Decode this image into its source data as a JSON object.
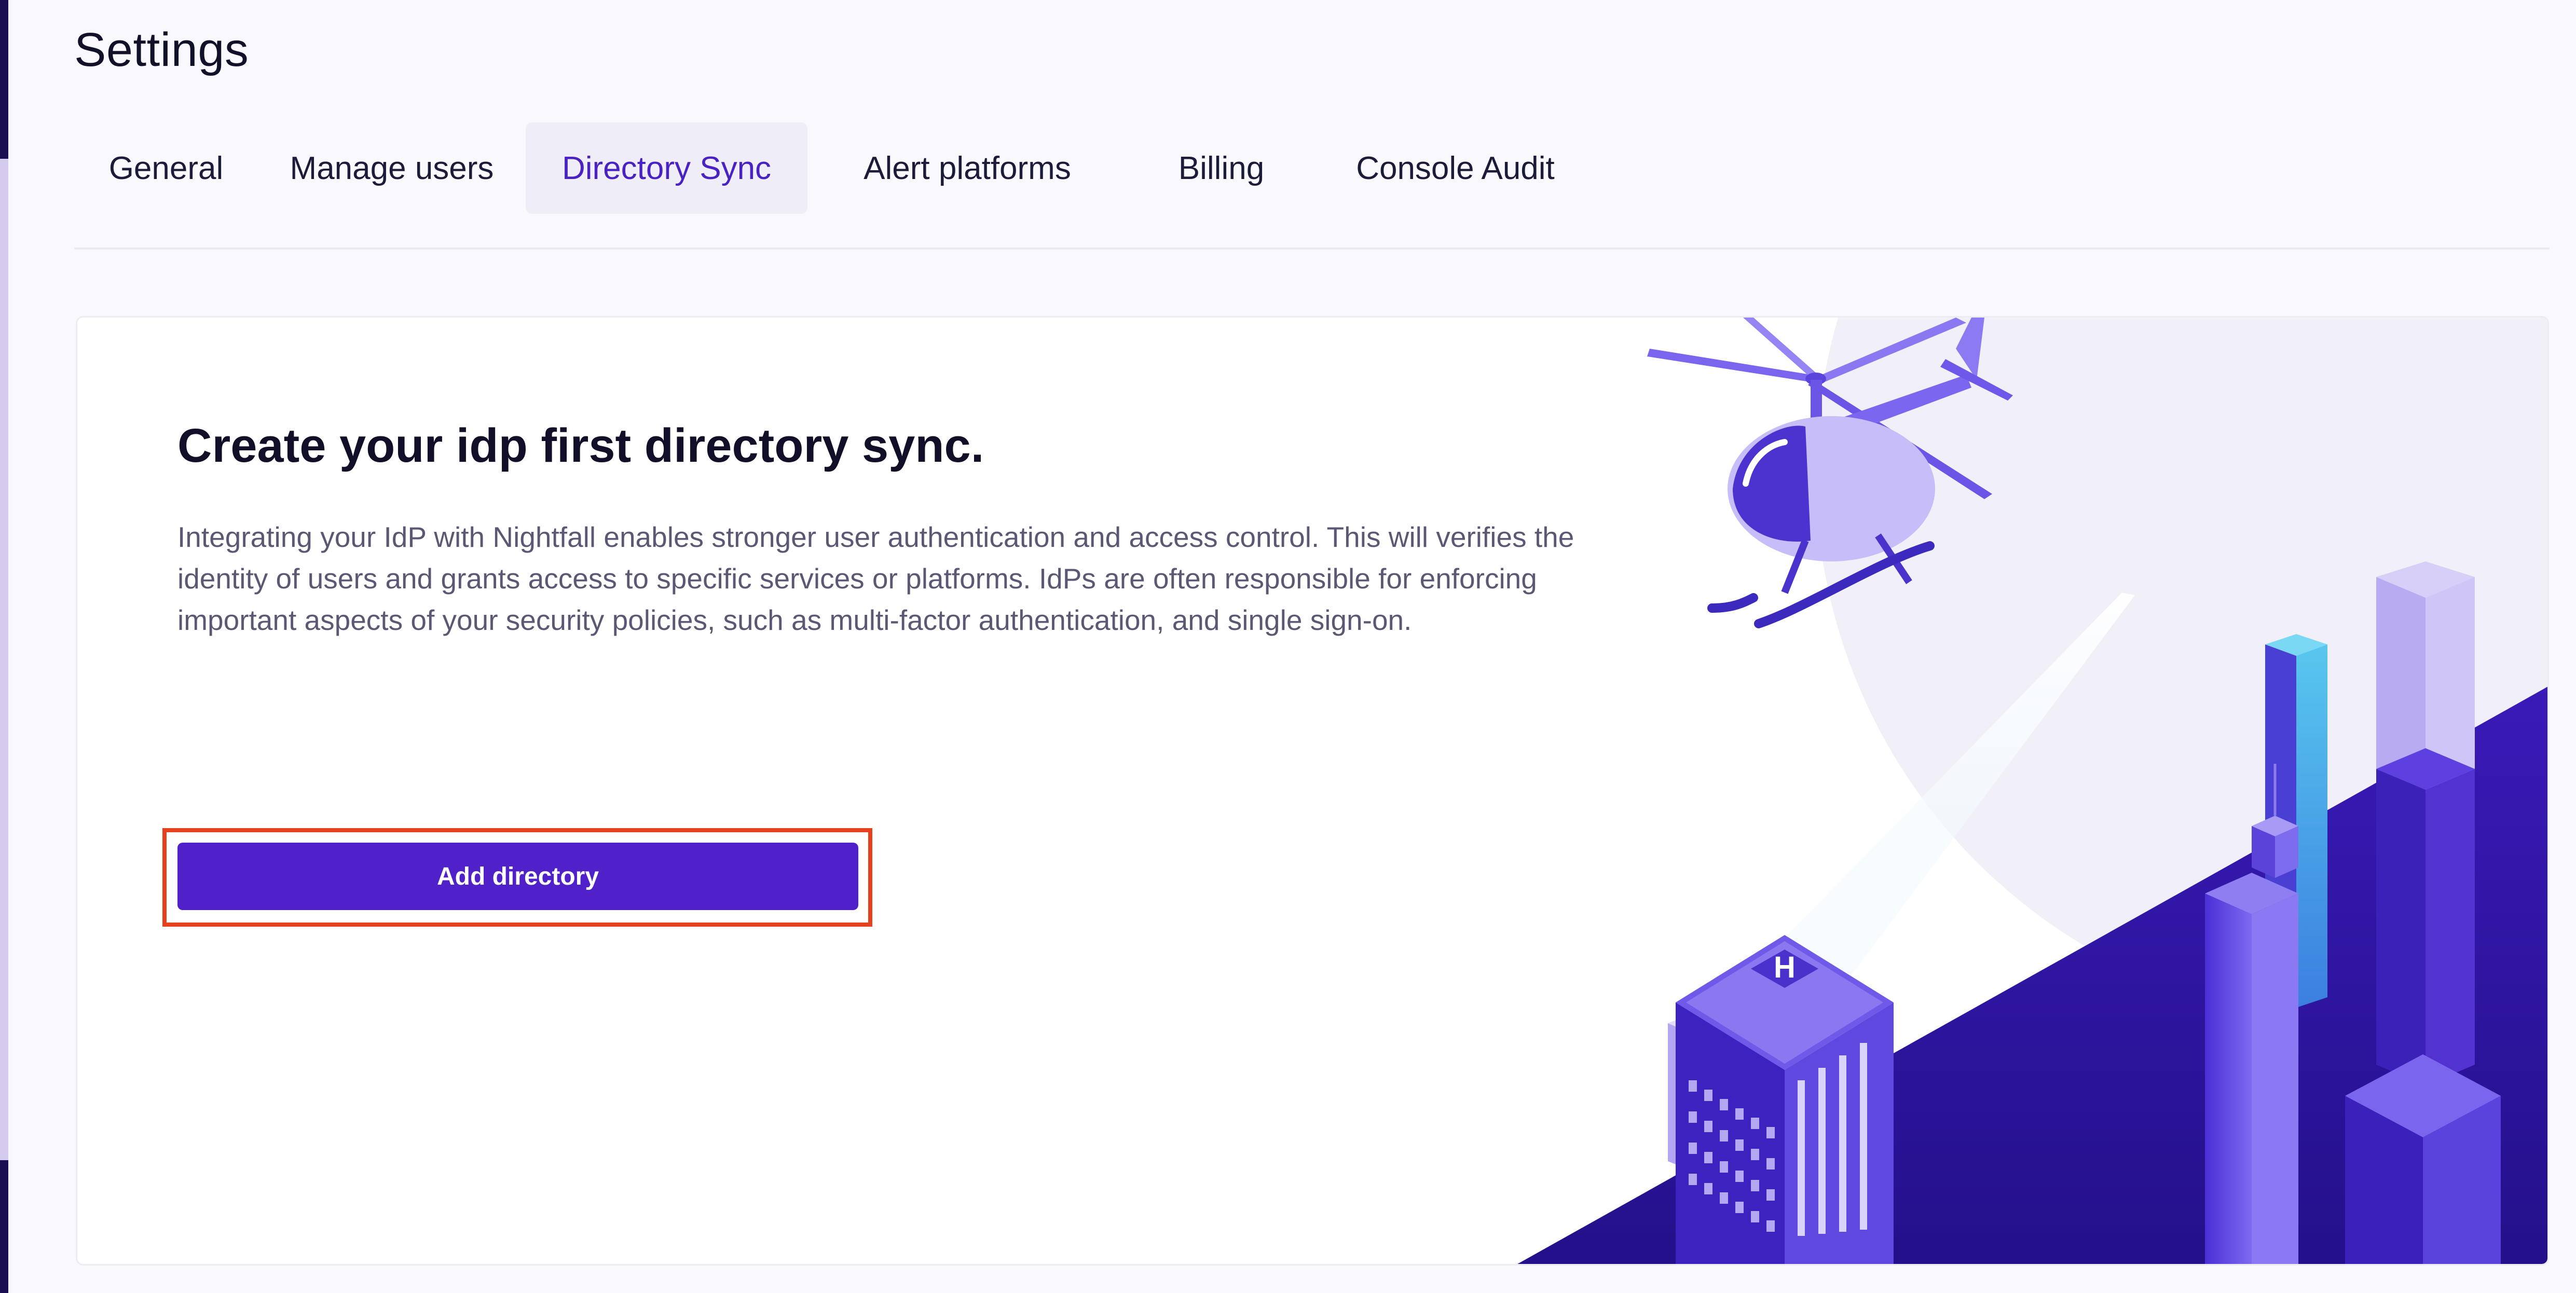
{
  "page": {
    "title": "Settings"
  },
  "tabs": [
    {
      "label": "General",
      "active": false
    },
    {
      "label": "Manage users",
      "active": false
    },
    {
      "label": "Directory Sync",
      "active": true
    },
    {
      "label": "Alert platforms",
      "active": false
    },
    {
      "label": "Billing",
      "active": false
    },
    {
      "label": "Console Audit",
      "active": false
    }
  ],
  "card": {
    "title": "Create your idp first directory sync.",
    "description": "Integrating your IdP with Nightfall enables stronger user authentication and access control. This will verifies the identity of users and grants access to specific services or platforms. IdPs are often responsible for enforcing important aspects of your security policies, such as multi-factor authentication, and single sign-on.",
    "button_label": "Add directory",
    "illustration": "helicopter-city-illustration",
    "helipad_letter": "H"
  },
  "colors": {
    "accent": "#5020c8",
    "active_tab_text": "#4a22c4",
    "active_tab_bg": "#efedf8",
    "highlight": "#e5411f"
  }
}
